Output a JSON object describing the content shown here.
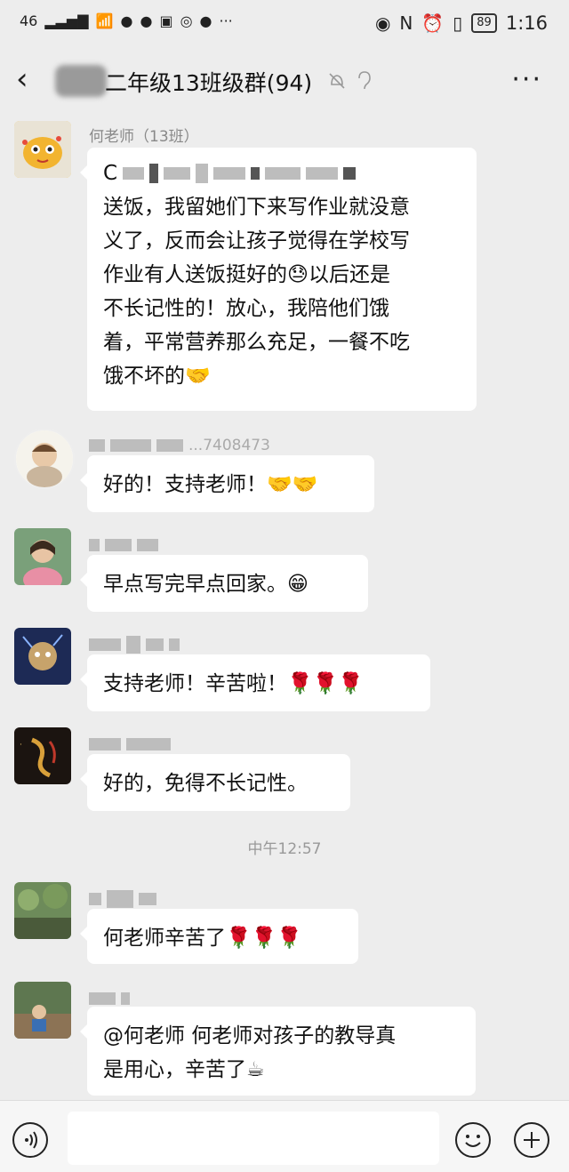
{
  "status_bar": {
    "signal": "46",
    "battery": "89",
    "time": "1:16"
  },
  "nav": {
    "title": "二年级13班级群(94)"
  },
  "messages": [
    {
      "sender": "何老师（13班）",
      "text_lines": [
        "送饭，我留她们下来写作业就没意",
        "义了，反而会让孩子觉得在学校写",
        "作业有人送饭挺好的😓以后还是",
        "不长记性的！放心，我陪他们饿",
        "着，平常营养那么充足，一餐不吃",
        "饿不坏的🤝"
      ],
      "first_line_partial": "C"
    },
    {
      "sender_partial": "...7408473",
      "text": "好的！支持老师！🤝🤝"
    },
    {
      "text": "早点写完早点回家。😁"
    },
    {
      "text": "支持老师！辛苦啦！🌹🌹🌹"
    },
    {
      "text": "好的，免得不长记性。"
    },
    {
      "text": "何老师辛苦了🌹🌹🌹"
    },
    {
      "text_lines": [
        "@何老师  何老师对孩子的教导真",
        "是用心，辛苦了☕"
      ]
    }
  ],
  "timestamp": "中午12:57"
}
